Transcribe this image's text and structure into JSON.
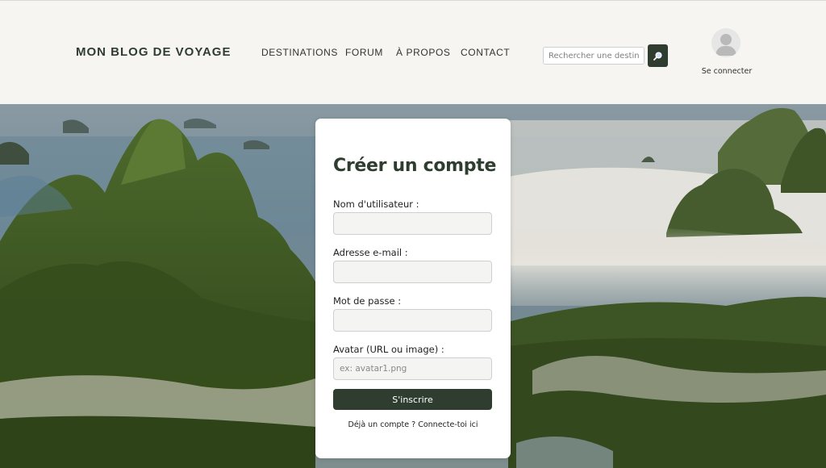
{
  "header": {
    "logo": "MON BLOG DE VOYAGE",
    "nav": [
      {
        "label": "DESTINATIONS"
      },
      {
        "label": "FORUM"
      },
      {
        "label": "À PROPOS"
      },
      {
        "label": "CONTACT"
      }
    ],
    "search": {
      "placeholder": "Rechercher une destination",
      "button_icon": "search-icon"
    },
    "account": {
      "icon": "user-avatar-icon",
      "label": "Se connecter"
    }
  },
  "form": {
    "title": "Créer un compte",
    "fields": [
      {
        "label": "Nom d'utilisateur :",
        "value": "",
        "placeholder": ""
      },
      {
        "label": "Adresse e-mail :",
        "value": "",
        "placeholder": ""
      },
      {
        "label": "Mot de passe :",
        "value": "",
        "placeholder": ""
      },
      {
        "label": "Avatar (URL ou image) :",
        "value": "",
        "placeholder": "ex: avatar1.png"
      }
    ],
    "submit_label": "S'inscrire",
    "signin_prompt": "Déjà un compte ?",
    "signin_link": "Connecte-toi ici"
  },
  "colors": {
    "brand_green": "#2f3d30",
    "header_bg": "#f6f5f2"
  }
}
